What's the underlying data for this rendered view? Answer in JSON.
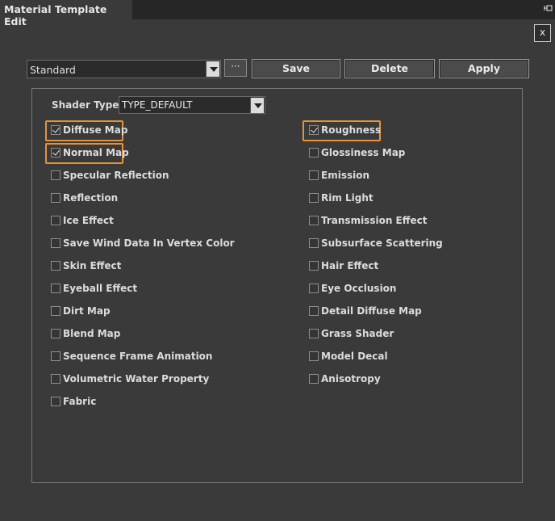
{
  "window": {
    "title": "Material Template Edit",
    "close_label": "x"
  },
  "toolbar": {
    "preset_value": "Standard",
    "more_label": "···",
    "save_label": "Save",
    "delete_label": "Delete",
    "apply_label": "Apply"
  },
  "shader": {
    "label": "Shader Type:",
    "value": "TYPE_DEFAULT"
  },
  "left_options": [
    {
      "label": "Diffuse Map",
      "checked": true
    },
    {
      "label": "Normal Map",
      "checked": true
    },
    {
      "label": "Specular Reflection",
      "checked": false
    },
    {
      "label": "Reflection",
      "checked": false
    },
    {
      "label": "Ice Effect",
      "checked": false
    },
    {
      "label": "Save Wind Data In Vertex Color",
      "checked": false
    },
    {
      "label": "Skin Effect",
      "checked": false
    },
    {
      "label": "Eyeball Effect",
      "checked": false
    },
    {
      "label": "Dirt Map",
      "checked": false
    },
    {
      "label": "Blend Map",
      "checked": false
    },
    {
      "label": "Sequence Frame Animation",
      "checked": false
    },
    {
      "label": "Volumetric Water Property",
      "checked": false
    },
    {
      "label": "Fabric",
      "checked": false
    }
  ],
  "right_options": [
    {
      "label": "Roughness",
      "checked": true
    },
    {
      "label": "Glossiness Map",
      "checked": false
    },
    {
      "label": "Emission",
      "checked": false
    },
    {
      "label": "Rim Light",
      "checked": false
    },
    {
      "label": "Transmission Effect",
      "checked": false
    },
    {
      "label": "Subsurface Scattering",
      "checked": false
    },
    {
      "label": "Hair Effect",
      "checked": false
    },
    {
      "label": "Eye Occlusion",
      "checked": false
    },
    {
      "label": "Detail Diffuse Map",
      "checked": false
    },
    {
      "label": "Grass Shader",
      "checked": false
    },
    {
      "label": "Model Decal",
      "checked": false
    },
    {
      "label": "Anisotropy",
      "checked": false
    }
  ],
  "colors": {
    "highlight": "#e8923a",
    "background": "#3a3a3a",
    "tabbar": "#262626"
  }
}
